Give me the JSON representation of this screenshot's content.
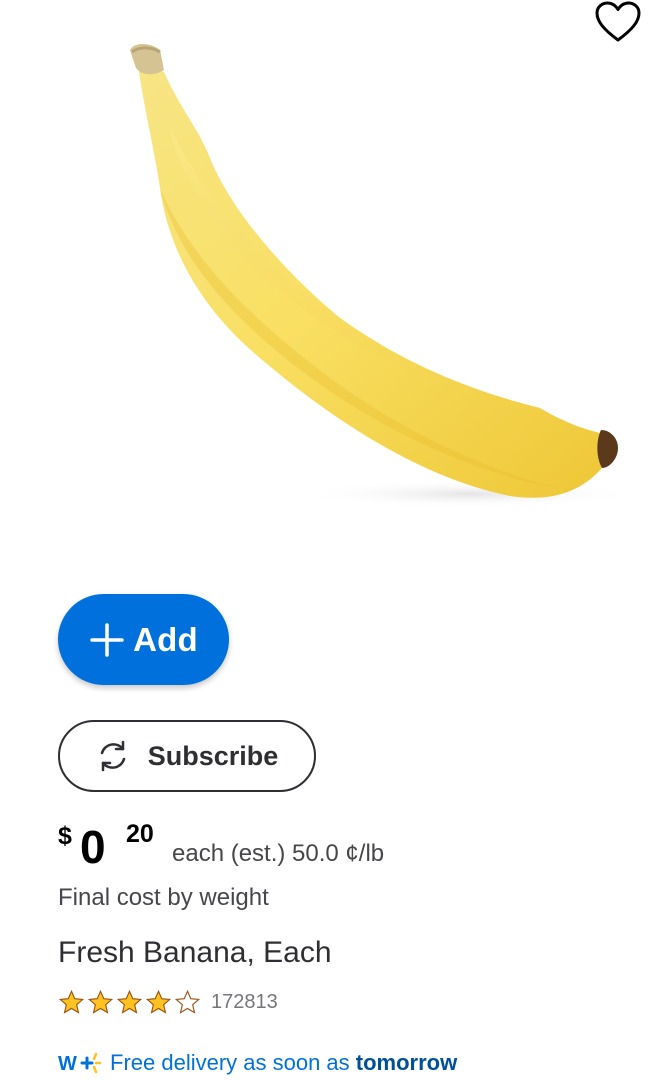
{
  "product": {
    "title": "Fresh Banana, Each",
    "image_alt": "banana"
  },
  "actions": {
    "add_label": "Add",
    "subscribe_label": "Subscribe"
  },
  "price": {
    "currency": "$",
    "dollars": "0",
    "cents": "20",
    "unit_text": "each (est.) 50.0 ¢/lb",
    "note": "Final cost by weight"
  },
  "rating": {
    "stars": 4.0,
    "max_stars": 5,
    "count": "172813"
  },
  "delivery": {
    "prefix": "Free delivery as soon as ",
    "emphasis": "tomorrow"
  },
  "icons": {
    "favorite": "heart-outline-icon",
    "add": "plus-icon",
    "subscribe": "refresh-icon",
    "walmart_plus": "walmart-plus-logo-icon"
  },
  "colors": {
    "primary": "#0071dc",
    "star": "#ffc220",
    "text": "#2e2f32",
    "muted": "#74767c"
  }
}
